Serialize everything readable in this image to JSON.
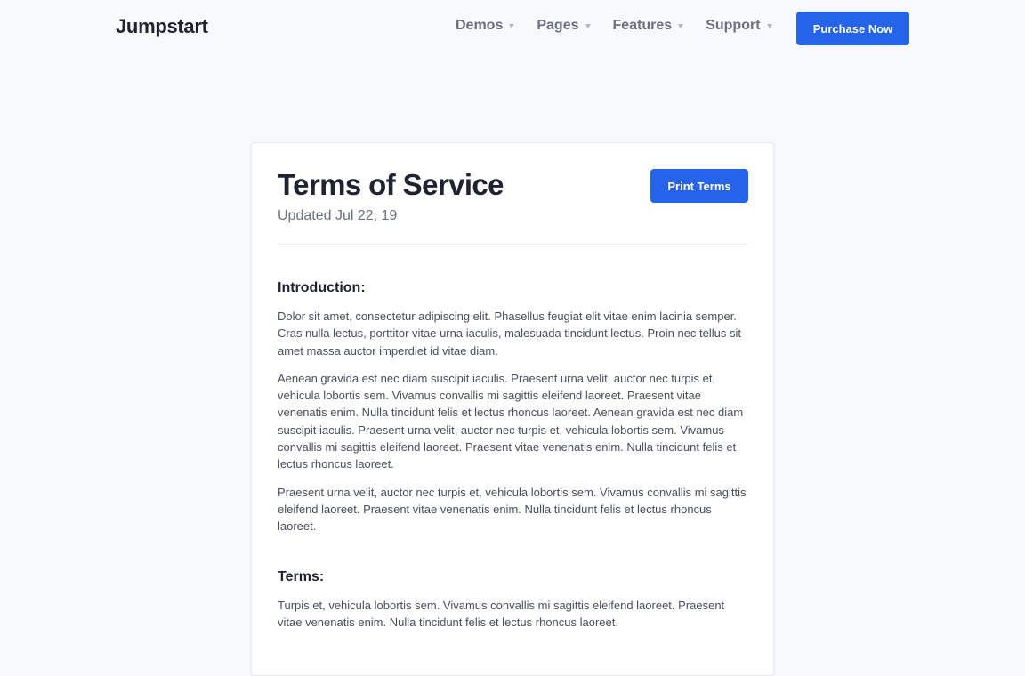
{
  "nav": {
    "brand": "Jumpstart",
    "items": [
      {
        "label": "Demos"
      },
      {
        "label": "Pages"
      },
      {
        "label": "Features"
      },
      {
        "label": "Support"
      }
    ],
    "cta_label": "Purchase Now"
  },
  "page": {
    "title": "Terms of Service",
    "updated": "Updated Jul 22, 19",
    "print_label": "Print Terms"
  },
  "sections": [
    {
      "heading": "Introduction:",
      "paragraphs": [
        "Dolor sit amet, consectetur adipiscing elit. Phasellus feugiat elit vitae enim lacinia semper. Cras nulla lectus, porttitor vitae urna iaculis, malesuada tincidunt lectus. Proin nec tellus sit amet massa auctor imperdiet id vitae diam.",
        "Aenean gravida est nec diam suscipit iaculis. Praesent urna velit, auctor nec turpis et, vehicula lobortis sem. Vivamus convallis mi sagittis eleifend laoreet. Praesent vitae venenatis enim. Nulla tincidunt felis et lectus rhoncus laoreet. Aenean gravida est nec diam suscipit iaculis. Praesent urna velit, auctor nec turpis et, vehicula lobortis sem. Vivamus convallis mi sagittis eleifend laoreet. Praesent vitae venenatis enim. Nulla tincidunt felis et lectus rhoncus laoreet.",
        "Praesent urna velit, auctor nec turpis et, vehicula lobortis sem. Vivamus convallis mi sagittis eleifend laoreet. Praesent vitae venenatis enim. Nulla tincidunt felis et lectus rhoncus laoreet."
      ]
    },
    {
      "heading": "Terms:",
      "paragraphs": [
        "Turpis et, vehicula lobortis sem. Vivamus convallis mi sagittis eleifend laoreet. Praesent vitae venenatis enim. Nulla tincidunt felis et lectus rhoncus laoreet."
      ]
    }
  ],
  "colors": {
    "accent": "#2563eb",
    "background": "#f7f9fc",
    "card": "#ffffff"
  },
  "icons": {
    "nav_caret": "caret-down-icon"
  }
}
